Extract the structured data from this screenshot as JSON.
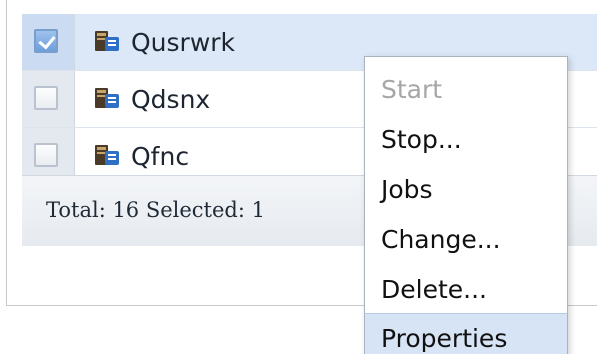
{
  "table": {
    "rows": [
      {
        "label": "Qusrwrk",
        "checked": true,
        "icon": "subsystem-icon"
      },
      {
        "label": "Qdsnx",
        "checked": false,
        "icon": "subsystem-icon"
      },
      {
        "label": "Qfnc",
        "checked": false,
        "icon": "subsystem-icon"
      }
    ]
  },
  "footer": {
    "status": "Total: 16 Selected: 1"
  },
  "context_menu": {
    "items": [
      {
        "label": "Start",
        "enabled": false
      },
      {
        "label": "Stop...",
        "enabled": true
      },
      {
        "label": "Jobs",
        "enabled": true
      },
      {
        "label": "Change...",
        "enabled": true
      },
      {
        "label": "Delete...",
        "enabled": true
      },
      {
        "label": "Properties",
        "enabled": true,
        "highlighted": true
      }
    ]
  },
  "colors": {
    "selected_row": "#dce8f8",
    "menu_highlight": "#d7e4f5",
    "disabled_text": "#a6a6a6"
  }
}
